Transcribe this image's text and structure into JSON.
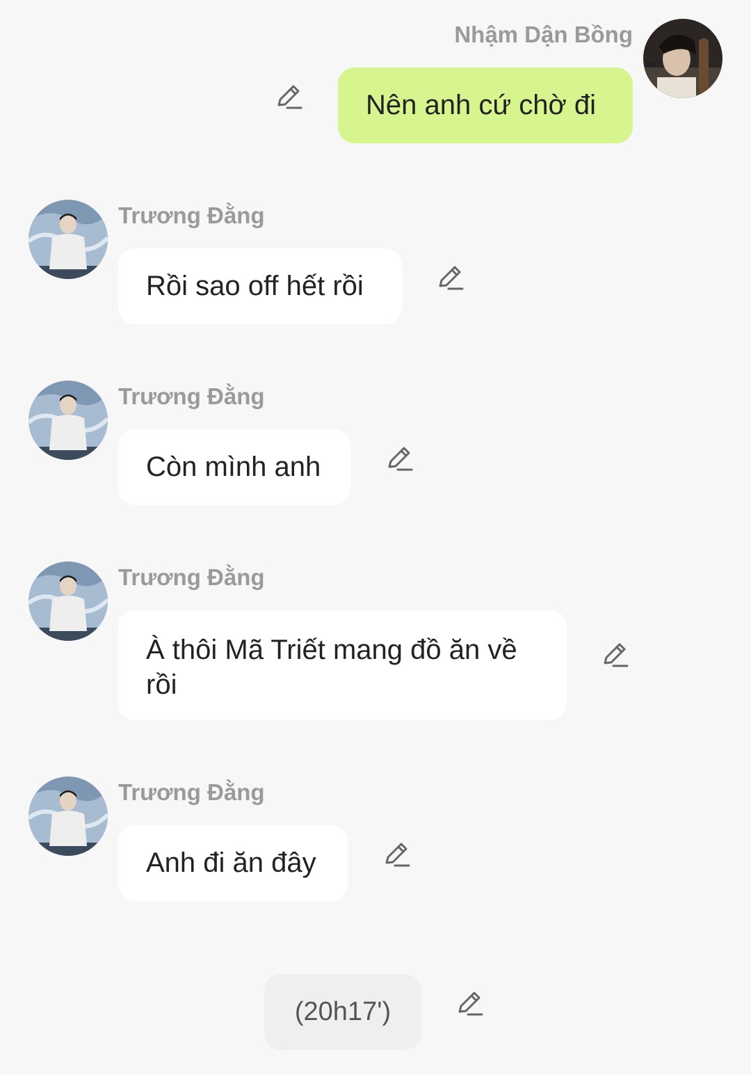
{
  "messages": [
    {
      "sender": "Nhậm Dận Bồng",
      "text": "Nên anh cứ chờ đi"
    },
    {
      "sender": "Trương Đằng",
      "text": "Rồi sao off hết rồi"
    },
    {
      "sender": "Trương Đằng",
      "text": "Còn mình anh"
    },
    {
      "sender": "Trương Đằng",
      "text": "À thôi Mã Triết mang đồ ăn về rồi"
    },
    {
      "sender": "Trương Đằng",
      "text": "Anh đi ăn đây"
    }
  ],
  "system_message": {
    "text": "(20h17')"
  },
  "icons": {
    "edit": "pencil-edit-icon",
    "avatar_right": "avatar-nham-dan-bong",
    "avatar_left": "avatar-truong-dang"
  },
  "colors": {
    "background": "#f7f7f7",
    "bubble_left": "#ffffff",
    "bubble_right": "#d6f58f",
    "bubble_system": "#efefef",
    "name": "#9a9a9a"
  }
}
